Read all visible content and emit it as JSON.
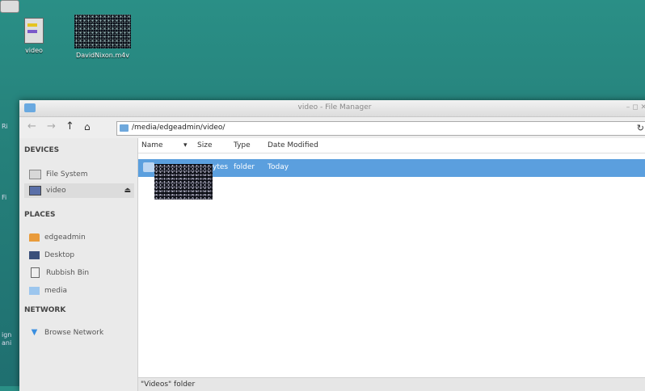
{
  "desktop": {
    "icons": [
      {
        "label": "video"
      },
      {
        "label": "DavidNixon.m4v"
      }
    ],
    "edge_chars": [
      "Ri",
      "Fi",
      "ign",
      "ani"
    ]
  },
  "window": {
    "title": "video - File Manager",
    "controls": "– ◻ ✕",
    "toolbar": {
      "back_icon": "←",
      "forward_icon": "→",
      "up_icon": "↑",
      "home_icon": "⌂",
      "path": "/media/edgeadmin/video/",
      "refresh_icon": "↻"
    },
    "sidebar": {
      "devices_header": "DEVICES",
      "devices": [
        {
          "label": "File System",
          "icon": "drive-icon"
        },
        {
          "label": "video",
          "icon": "usb-drive-icon",
          "eject": "⏏"
        }
      ],
      "places_header": "PLACES",
      "places": [
        {
          "label": "edgeadmin",
          "icon": "home-icon"
        },
        {
          "label": "Desktop",
          "icon": "desktop-icon"
        },
        {
          "label": "Rubbish Bin",
          "icon": "trash-icon"
        },
        {
          "label": "media",
          "icon": "folder-icon"
        }
      ],
      "network_header": "NETWORK",
      "network": [
        {
          "label": "Browse Network",
          "icon": "network-icon"
        }
      ]
    },
    "columns": {
      "name": "Name",
      "sort": "▾",
      "size": "Size",
      "type": "Type",
      "modified": "Date Modified"
    },
    "rows": [
      {
        "size": "ytes",
        "type": "folder",
        "modified": "Today"
      }
    ],
    "status": "\"Videos\" folder",
    "colors": {
      "selection": "#5b9fde",
      "desktop": "#25807a"
    }
  }
}
